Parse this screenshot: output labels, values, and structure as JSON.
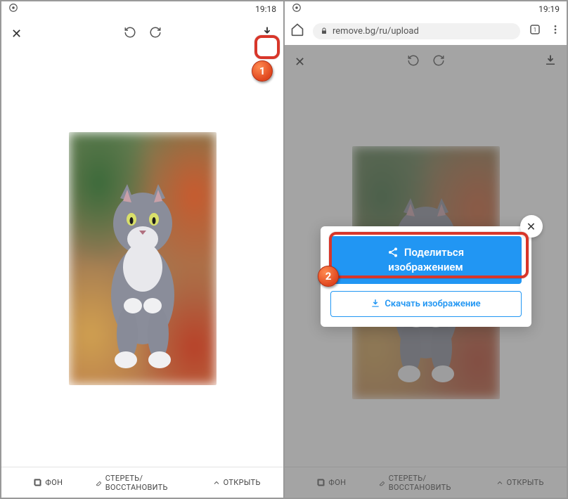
{
  "status": {
    "time_left": "19:18",
    "time_right": "19:19"
  },
  "browser": {
    "url": "remove.bg/ru/upload"
  },
  "bottom": {
    "bg": "ФОН",
    "erase": "СТЕРЕТЬ/ВОССТАНОВИТЬ",
    "open": "ОТКРЫТЬ"
  },
  "popup": {
    "share_line1": "Поделиться",
    "share_line2": "изображением",
    "download": "Скачать изображение"
  },
  "callouts": {
    "one": "1",
    "two": "2"
  }
}
